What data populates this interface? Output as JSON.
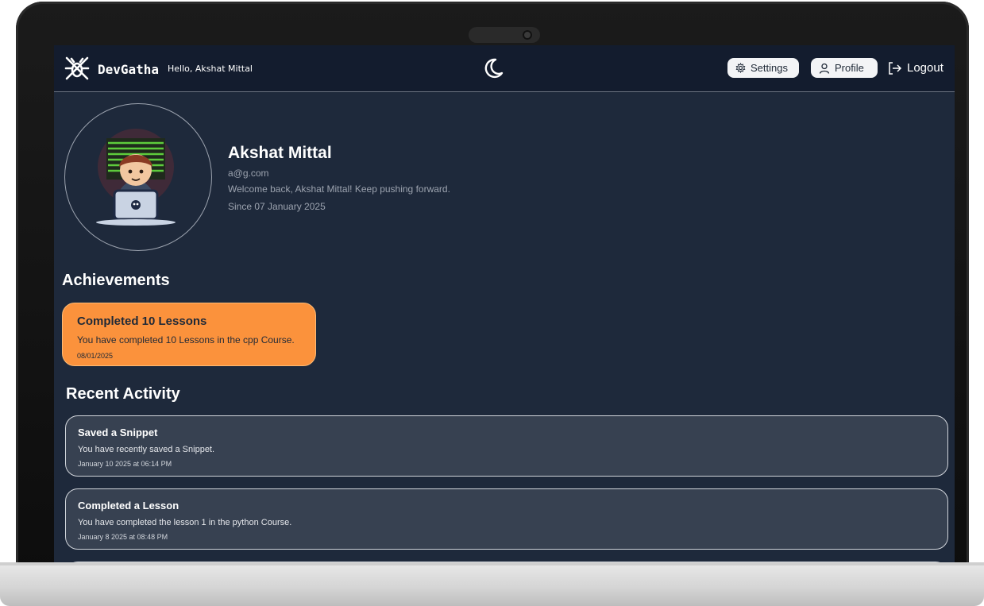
{
  "navbar": {
    "brand": "DevGatha",
    "greeting": "Hello, Akshat Mittal",
    "settings_label": "Settings",
    "profile_label": "Profile",
    "logout_label": "Logout",
    "icons": [
      "bug-logo-icon",
      "moon-icon",
      "gear-icon",
      "user-icon",
      "logout-icon"
    ]
  },
  "profile": {
    "name": "Akshat Mittal",
    "email": "a@g.com",
    "welcome": "Welcome back, Akshat Mittal! Keep pushing forward.",
    "since": "Since 07 January 2025"
  },
  "achievements": {
    "heading": "Achievements",
    "items": [
      {
        "title": "Completed 10 Lessons",
        "description": "You have completed 10 Lessons in the cpp Course.",
        "date": "08/01/2025",
        "color": "#fb923c"
      }
    ]
  },
  "recent_activity": {
    "heading": "Recent Activity",
    "items": [
      {
        "title": "Saved a Snippet",
        "description": "You have recently saved a Snippet.",
        "date": "January 10 2025 at 06:14 PM"
      },
      {
        "title": "Completed a Lesson",
        "description": "You have completed the lesson 1 in the python Course.",
        "date": "January 8 2025 at 08:48 PM"
      }
    ]
  },
  "colors": {
    "background": "#1e293b",
    "navbar": "#131c2e",
    "achievement": "#fb923c",
    "activity_card": "#374151"
  }
}
